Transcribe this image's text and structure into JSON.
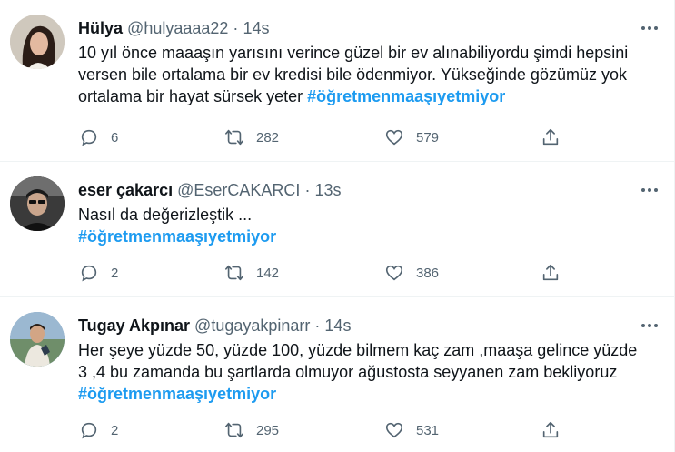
{
  "tweets": [
    {
      "name": "Hülya",
      "handle": "@hulyaaaa22",
      "time": "14s",
      "text": "10 yıl önce maaaşın yarısını verince güzel bir ev alınabiliyordu şimdi hepsini versen bile ortalama bir ev kredisi bile ödenmiyor. Yükseğinde gözümüz yok ortalama bir hayat sürsek yeter",
      "hashtag": "#öğretmenmaaşıyetmiyor",
      "replies": "6",
      "retweets": "282",
      "likes": "579"
    },
    {
      "name": "eser çakarcı",
      "handle": "@EserCAKARCI",
      "time": "13s",
      "text": "Nasıl da değerizleştik ...",
      "hashtag": "#öğretmenmaaşıyetmiyor",
      "replies": "2",
      "retweets": "142",
      "likes": "386"
    },
    {
      "name": "Tugay Akpınar",
      "handle": "@tugayakpinarr",
      "time": "14s",
      "text": "Her şeye yüzde 50, yüzde 100, yüzde bilmem kaç zam ,maaşa gelince yüzde 3 ,4 bu zamanda bu şartlarda olmuyor ağustosta seyyanen zam bekliyoruz",
      "hashtag": "#öğretmenmaaşıyetmiyor",
      "replies": "2",
      "retweets": "295",
      "likes": "531"
    }
  ],
  "colors": {
    "text": "#0f1419",
    "secondary": "#536471",
    "link": "#1d9bf0",
    "divider": "#eff3f4"
  },
  "icons": {
    "reply": "reply-icon",
    "retweet": "retweet-icon",
    "like": "heart-icon",
    "share": "share-icon",
    "more": "more-icon"
  },
  "separator": "·"
}
